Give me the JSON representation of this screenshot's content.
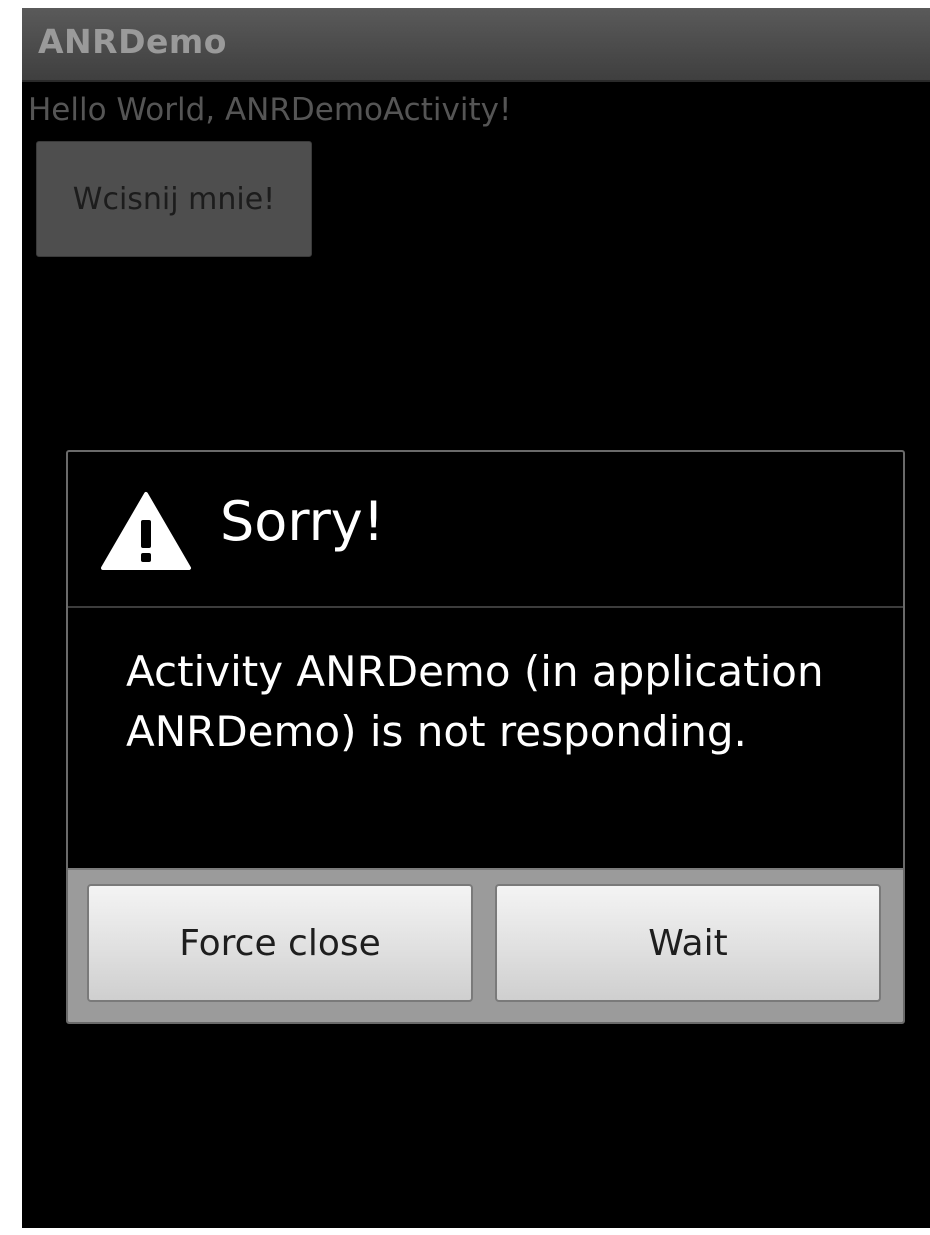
{
  "app": {
    "title": "ANRDemo"
  },
  "content": {
    "hello_text": "Hello World, ANRDemoActivity!",
    "button_label": "Wcisnij mnie!"
  },
  "dialog": {
    "icon": "warning-icon",
    "title": "Sorry!",
    "message": "Activity ANRDemo (in application ANRDemo) is not responding.",
    "buttons": {
      "force_close": "Force close",
      "wait": "Wait"
    }
  },
  "colors": {
    "screen_background": "#000000",
    "title_bar": "#4a4a4a",
    "dialog_button_bar": "#9b9b9b"
  }
}
